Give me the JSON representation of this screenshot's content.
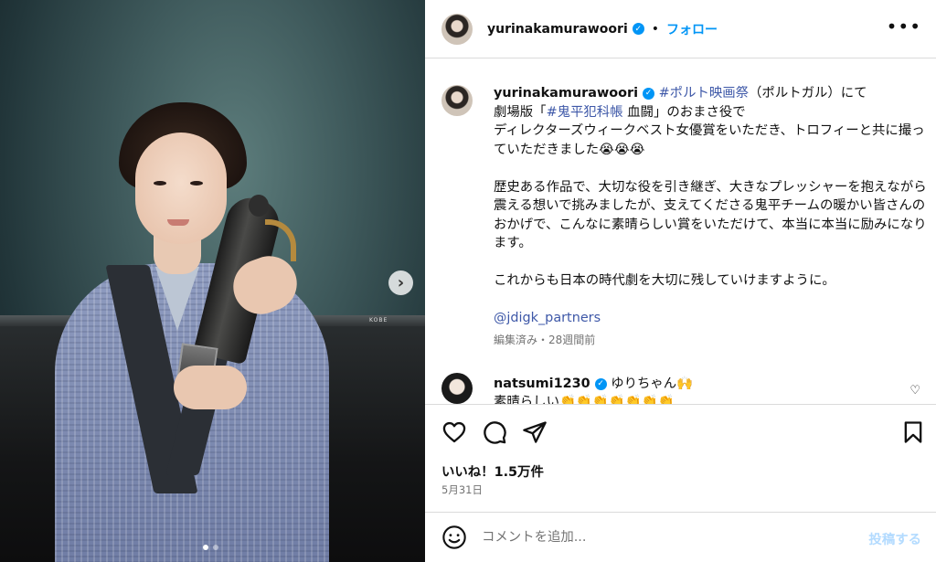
{
  "post": {
    "username": "yurinakamurawoori",
    "follow_label": "フォロー",
    "separator": "•",
    "more_label": "•••"
  },
  "caption": {
    "username": "yurinakamurawoori",
    "line1_tag": "#ポルト映画祭",
    "line1_rest": "（ポルトガル）にて",
    "line2_pre": "劇場版「",
    "line2_tag": "#鬼平犯科帳",
    "line2_rest": " 血闘」のおまさ役で",
    "line3": "ディレクターズウィークベスト女優賞をいただき、トロフィーと共に撮っていただきました😭😭😭",
    "paragraph2": "歴史ある作品で、大切な役を引き継ぎ、大きなプレッシャーを抱えながら震える想いで挑みましたが、支えてくださる鬼平チームの暖かい皆さんのおかげで、こんなに素晴らしい賞をいただけて、本当に本当に励みになります。",
    "paragraph3": "これからも日本の時代劇を大切に残していけますように。",
    "mention": "@jdigk_partners",
    "meta": "編集済み・28週間前"
  },
  "comment": {
    "username": "natsumi1230",
    "text": "ゆりちゃん🙌",
    "text2": "素晴らしい👏👏👏👏👏👏👏"
  },
  "engagement": {
    "likes": "いいね！1.5万件",
    "date": "5月31日"
  },
  "add_comment": {
    "placeholder": "コメントを追加...",
    "post_label": "投稿する"
  },
  "media": {
    "rail_label": "KOBE",
    "next_arrow": "›",
    "carousel_count": 2,
    "carousel_active": 1
  },
  "colors": {
    "link": "#3e58a8",
    "accent": "#0095f6",
    "muted": "#737373",
    "post_disabled": "#b3dbff"
  }
}
